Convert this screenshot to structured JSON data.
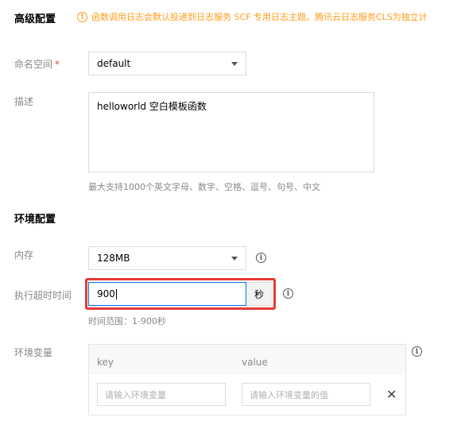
{
  "advanced": {
    "title": "高级配置",
    "notice": "函数调用日志会默认投递到日志服务 SCF 专用日志主题。腾讯云日志服务CLS为独立计",
    "notice_icon": "warning-circle-icon"
  },
  "namespace": {
    "label": "命名空间",
    "required_mark": "*",
    "value": "default"
  },
  "description": {
    "label": "描述",
    "value": "helloworld 空白模板函数",
    "hint": "最大支持1000个英文字母、数字、空格、逗号、句号、中文"
  },
  "environment": {
    "title": "环境配置",
    "memory": {
      "label": "内存",
      "value": "128MB"
    },
    "timeout": {
      "label": "执行超时时间",
      "value": "900",
      "unit": "秒",
      "hint": "时间范围：1-900秒"
    },
    "env_vars": {
      "label": "环境变量",
      "key_header": "key",
      "value_header": "value",
      "key_placeholder": "请输入环境变量",
      "value_placeholder": "请输入环境变量的值",
      "delete_symbol": "✕"
    }
  },
  "colors": {
    "accent": "#006eff",
    "warning": "#ff9c19",
    "highlight": "#e53935"
  }
}
